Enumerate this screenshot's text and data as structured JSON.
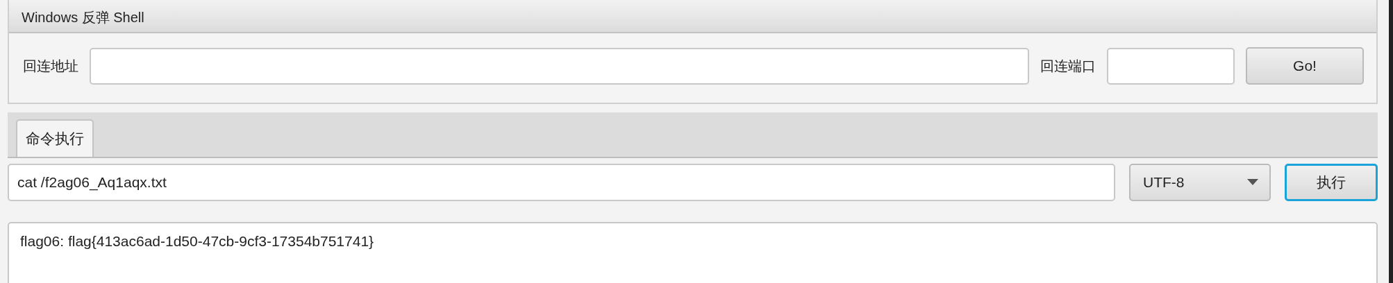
{
  "panel": {
    "title": "Windows 反弹 Shell",
    "address_label": "回连地址",
    "port_label": "回连端口",
    "go_button": "Go!"
  },
  "tabs": [
    {
      "label": "命令执行",
      "selected": true
    }
  ],
  "command": {
    "value": "cat /f2ag06_Aq1aqx.txt",
    "encoding": "UTF-8",
    "run_button": "执行"
  },
  "output": "flag06: flag{413ac6ad-1d50-47cb-9cf3-17354b751741}"
}
